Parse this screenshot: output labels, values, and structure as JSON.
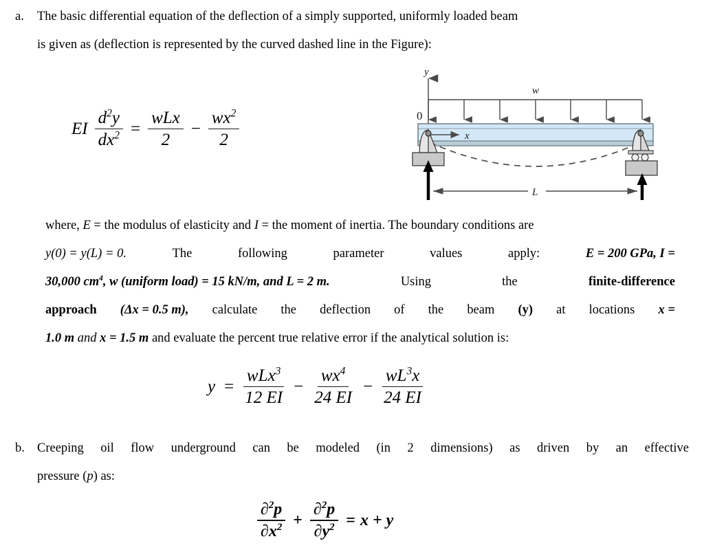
{
  "document": {
    "items": [
      {
        "marker": "a.",
        "lines": [
          "The basic differential equation of the deflection of a simply supported, uniformly loaded beam",
          "is given as (deflection is represented by the curved dashed line in the Figure):"
        ]
      },
      {
        "marker": "b.",
        "lines": [
          "Creeping oil flow underground can be modeled (in 2 dimensions) as driven by an effective",
          "pressure (p) as:"
        ]
      }
    ],
    "paragraph_where": {
      "line1": {
        "text_1": "where, ",
        "var_E": "E",
        "text_2": " = the modulus of elasticity and ",
        "var_I": "I",
        "text_3": " = the moment of inertia. The boundary conditions are"
      },
      "line2": {
        "segments": [
          "y(0)  =  y(L)  =  0.",
          "The",
          "following",
          "parameter",
          "values",
          "apply:",
          "E  =  200 GPa, I  ="
        ]
      },
      "line3": {
        "segments": [
          "30,000 cm4, w (uniform load)  =  15 kN/m, and L  =  2 m.",
          "Using",
          "the",
          "finite-difference"
        ],
        "cm_exponent": "4"
      },
      "line4": {
        "segments": [
          "approach",
          "(Δx  =  0.5 m),",
          "calculate",
          "the",
          "deflection",
          "of",
          "the",
          "beam",
          "(y)",
          "at",
          "locations",
          "x  ="
        ]
      },
      "line5": {
        "text_bold_1": "1.0 m",
        "text_italic_1": " and ",
        "text_bold_2": "x = 1.5 m",
        "text_rest": " and evaluate the percent true relative error if the analytical solution is:"
      }
    },
    "equations": {
      "governing": {
        "lead": "EI",
        "num1": "d2y",
        "den1": "dx2",
        "equals": "=",
        "num2": "wLx",
        "den2": "2",
        "minus": "−",
        "num3": "wx2",
        "den3": "2",
        "sup_d": "2",
        "sup_dx": "2",
        "sup_wx": "2"
      },
      "analytical": {
        "lead": "y",
        "equals": "=",
        "num1": "wLx3",
        "den1": "12 EI",
        "minus1": "−",
        "num2": "wx4",
        "den2": "24 EI",
        "minus2": "−",
        "num3": "wL3x",
        "den3": "24 EI",
        "sup_x3": "3",
        "sup_x4": "4",
        "sup_L3": "3"
      },
      "pressure_pde": {
        "num1": "∂p",
        "den1": "∂x",
        "plus": "+",
        "num2": "∂p",
        "den2": "∂y",
        "equals": "=",
        "rhs": "x + y",
        "sup2": "2"
      }
    }
  },
  "figure": {
    "name": "simply-supported-beam-diagram",
    "labels": {
      "y_axis": "y",
      "x_axis": "x",
      "origin": "0",
      "load": "w",
      "span": "L"
    },
    "colors": {
      "beam_fill": "#d3e8f7",
      "beam_edge": "#5b6b74",
      "support_fill": "#c9c9c9",
      "line": "#4a4a4a",
      "arrow_black": "#000000"
    },
    "load_arrow_count": 7,
    "reaction_arrows": 2,
    "deflection_curve": "dashed"
  }
}
